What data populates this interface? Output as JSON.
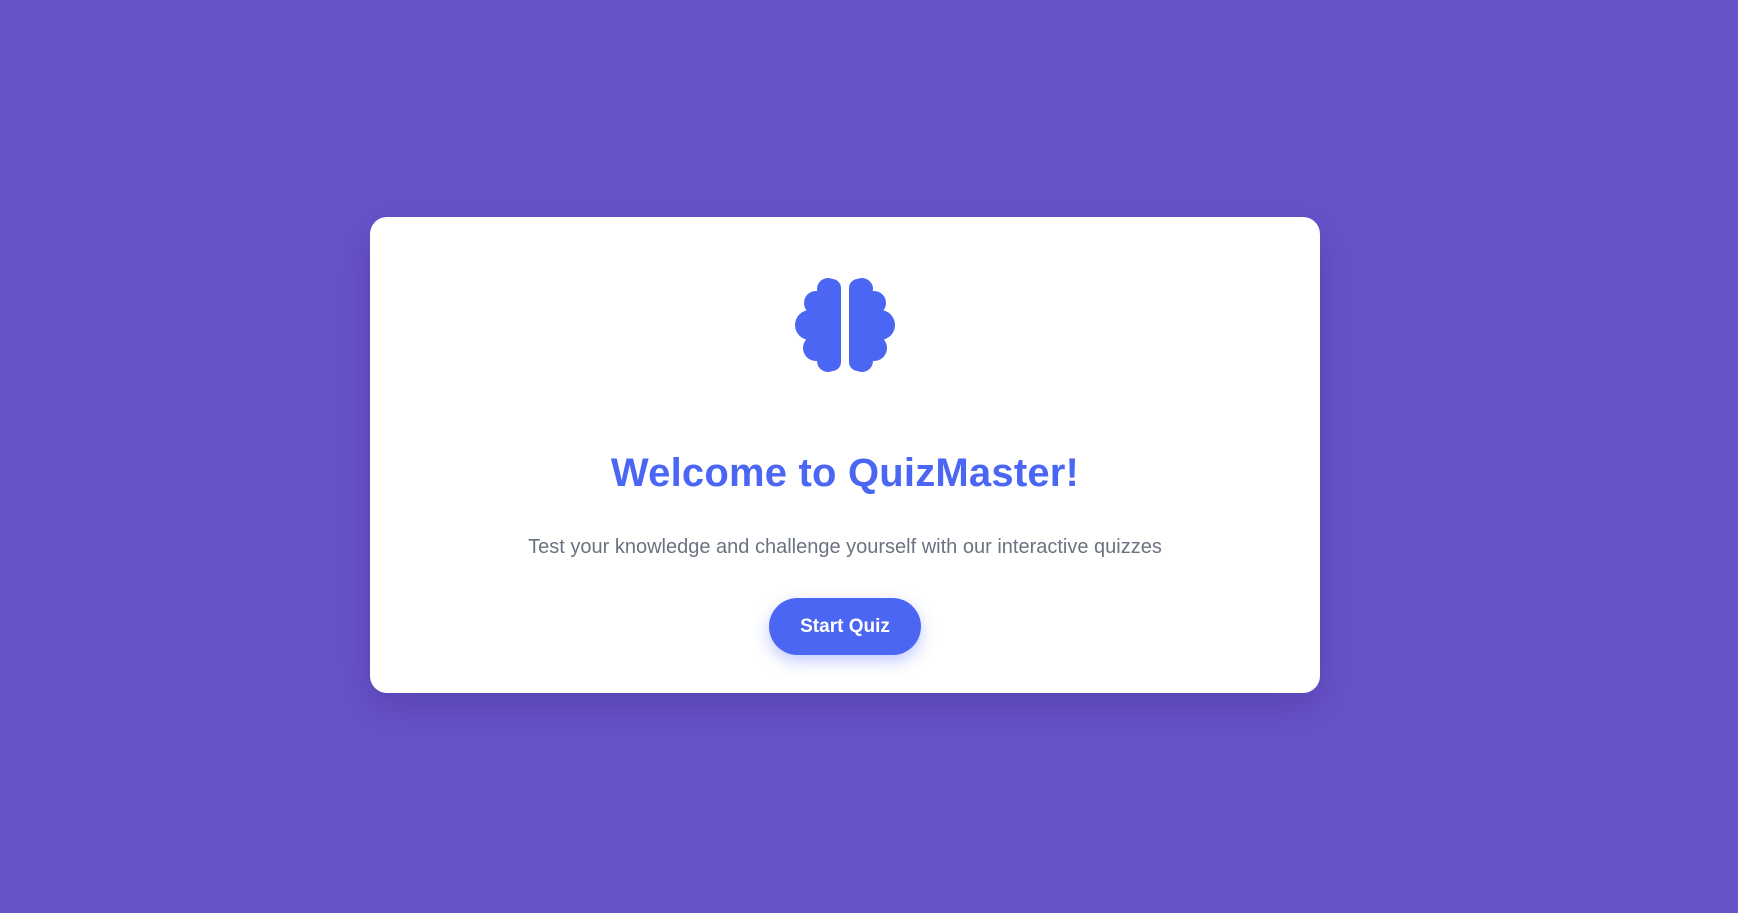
{
  "colors": {
    "background": "#6853c9",
    "card": "#ffffff",
    "accent": "#4a66f3",
    "subtitle": "#6b7380"
  },
  "welcome": {
    "icon": "brain-icon",
    "title": "Welcome to QuizMaster!",
    "subtitle": "Test your knowledge and challenge yourself with our interactive quizzes",
    "start_button_label": "Start Quiz"
  }
}
